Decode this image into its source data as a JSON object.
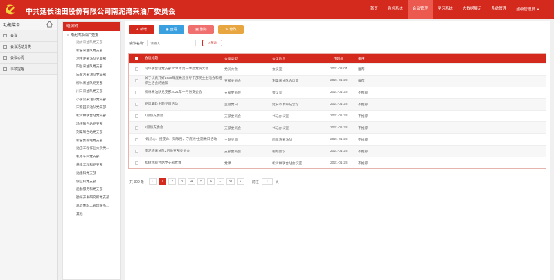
{
  "header": {
    "title": "中共延长油田股份有限公司南泥湾采油厂委员会",
    "nav": [
      {
        "label": "首页",
        "active": false
      },
      {
        "label": "党务系统",
        "active": false
      },
      {
        "label": "会议管理",
        "active": true
      },
      {
        "label": "学习系统",
        "active": false
      },
      {
        "label": "大数据展示",
        "active": false
      },
      {
        "label": "系统管理",
        "active": false
      },
      {
        "label": "超级管理员",
        "active": false
      }
    ]
  },
  "sidebar": {
    "title": "功能菜单",
    "items": [
      {
        "label": "会议"
      },
      {
        "label": "会议活动分类"
      },
      {
        "label": "会议心得"
      },
      {
        "label": "事项提醒"
      }
    ]
  },
  "org_tree": {
    "title": "组织树",
    "root": "南泥湾采油厂党委",
    "items": [
      "油坊采油队党支部",
      "新窑采油队党支部",
      "河庄坪采油队党支部",
      "阳台采油队党支部",
      "朱家河采油队党支部",
      "柳林采油队党支部",
      "川口采油队党支部",
      "小李渠采油队党支部",
      "宋家园采油队党支部",
      "松树林联合站党支部",
      "冯坪联合站党支部",
      "刘渠联合站党支部",
      "新窑集输站党支部",
      "油田工程作业大队党...",
      "机修车间党支部",
      "基建工程科党支部",
      "油建科党支部",
      "保卫科党支部",
      "后勤服务科党支部",
      "勘探开发研究所党支部",
      "离退休职工管理服务...",
      "其他"
    ]
  },
  "toolbar": {
    "add": "新增",
    "view": "查看",
    "delete": "删除",
    "edit": "修改"
  },
  "search": {
    "label": "会议名称:",
    "placeholder": "请输入",
    "button": "查询"
  },
  "table": {
    "headers": [
      "会议标题",
      "会议类型",
      "会议地点",
      "上传时间",
      "排序"
    ],
    "rows": [
      [
        "冯坪联合站党支部2021年第一季度党员大会",
        "党员大会",
        "会议室",
        "2021-02-04",
        "推荐"
      ],
      [
        "关于认真开好2020年度党员领导干部民主生活会和组织生活会的通知",
        "支部委员会",
        "刘渠采油队会议室",
        "2021-01-28",
        "推荐"
      ],
      [
        "柳林采油队党支部2021年一月份支委会",
        "支部委员会",
        "会议室",
        "2021-01-28",
        "不推荐"
      ],
      [
        "党风廉政主题党日活动",
        "主题党日",
        "延安市革命纪念馆",
        "2021-01-28",
        "不推荐"
      ],
      [
        "1月份支委会",
        "支部委员会",
        "书记办公室",
        "2021-01-28",
        "不推荐"
      ],
      [
        "2月份支委会",
        "支部委员会",
        "书记办公室",
        "2021-01-28",
        "不推荐"
      ],
      [
        "\"践初心、担使命、知敬畏、守底线\"主题党日活动",
        "主题党日",
        "南泥湾采油队",
        "2021-01-28",
        "不推荐"
      ],
      [
        "南泥湾采油队2月份支部委员会",
        "支部委员会",
        "视频会议",
        "2021-01-28",
        "不推荐"
      ],
      [
        "松树林联合站党支部党课",
        "党课",
        "松树林联合站会议室",
        "2021-01-28",
        "不推荐"
      ]
    ]
  },
  "pager": {
    "total": "共 309 条",
    "prev": "‹",
    "pages": [
      "1",
      "2",
      "3",
      "4",
      "5",
      "6",
      "···",
      "31"
    ],
    "next": "›",
    "goto_label": "前往",
    "goto_value": "1",
    "goto_suffix": "页"
  }
}
